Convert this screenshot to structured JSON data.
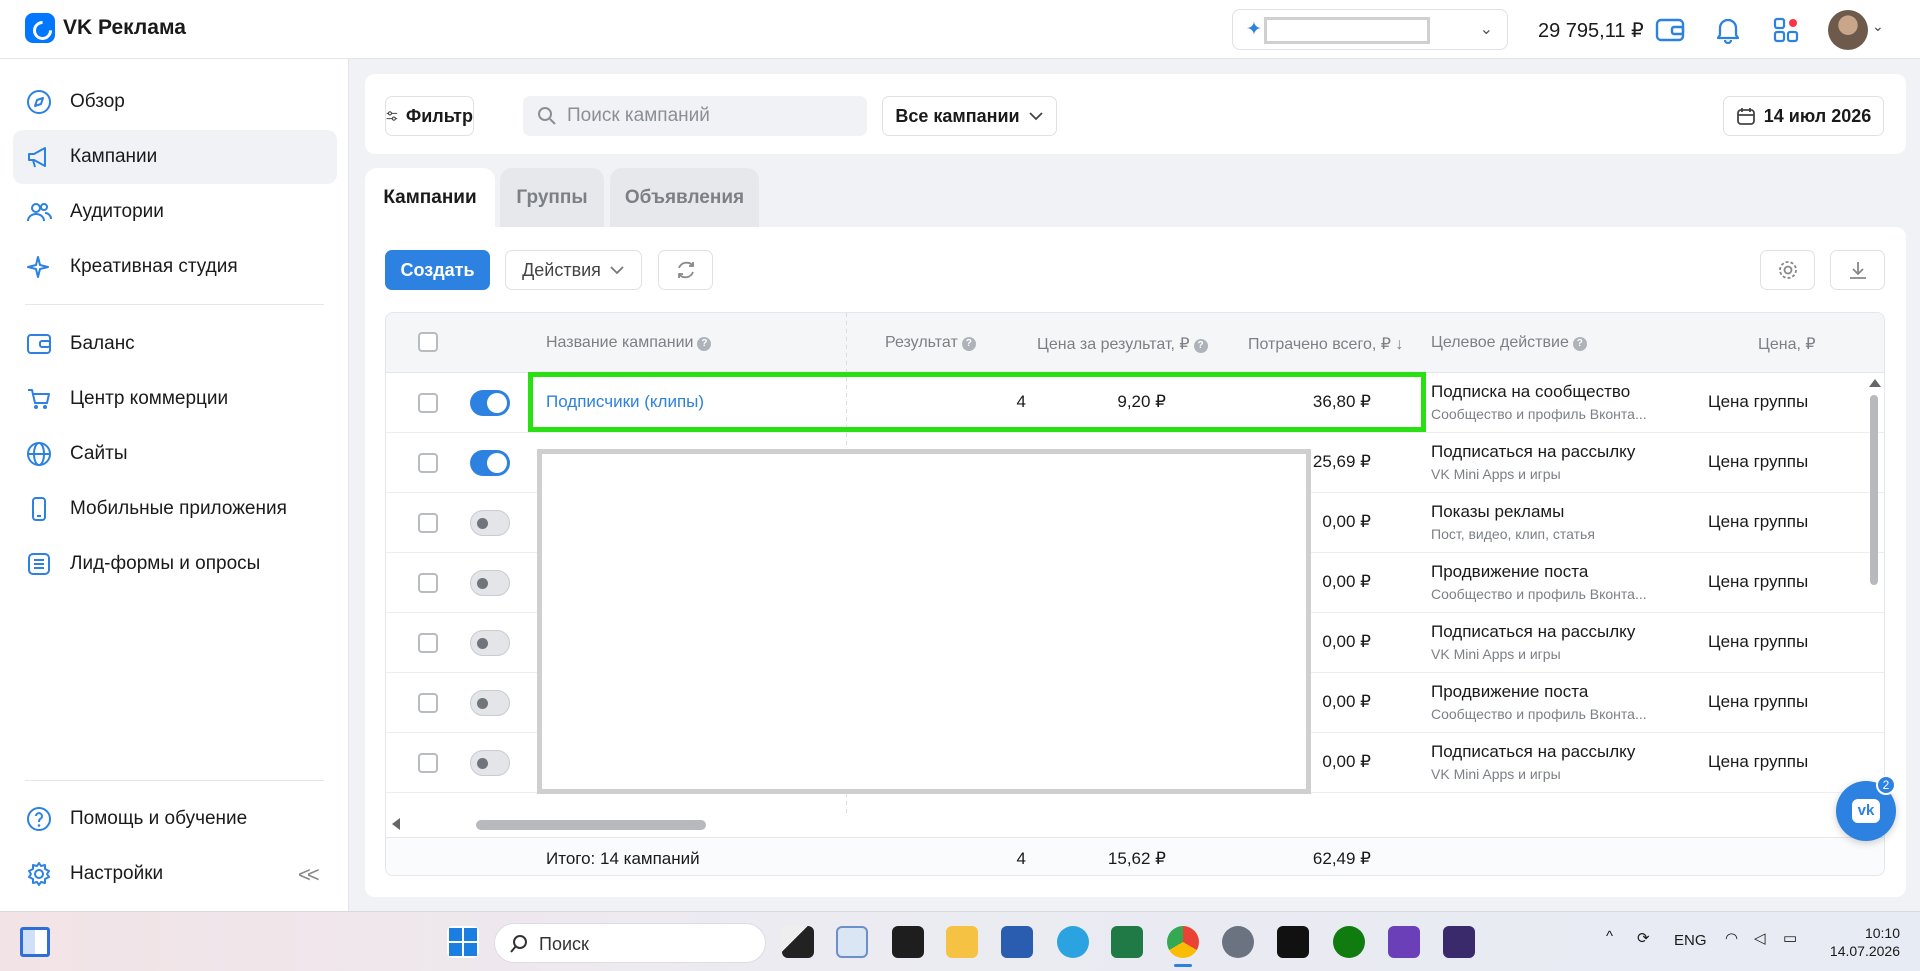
{
  "app": {
    "title": "VK Реклама"
  },
  "header": {
    "balance": "29 795,11 ₽",
    "colors": {
      "accent": "#2d81e0",
      "brand": "#0077ff"
    }
  },
  "sidebar": {
    "items": [
      {
        "label": "Обзор",
        "icon": "compass-icon"
      },
      {
        "label": "Кампании",
        "icon": "megaphone-icon",
        "active": true
      },
      {
        "label": "Аудитории",
        "icon": "users-icon"
      },
      {
        "label": "Креативная студия",
        "icon": "sparkle-icon"
      },
      {
        "label": "Баланс",
        "icon": "wallet-icon"
      },
      {
        "label": "Центр коммерции",
        "icon": "cart-icon"
      },
      {
        "label": "Сайты",
        "icon": "globe-icon"
      },
      {
        "label": "Мобильные приложения",
        "icon": "phone-icon"
      },
      {
        "label": "Лид-формы и опросы",
        "icon": "list-icon"
      }
    ],
    "bottom": [
      {
        "label": "Помощь и обучение",
        "icon": "help-icon"
      },
      {
        "label": "Настройки",
        "icon": "gear-icon"
      }
    ],
    "collapse_label": "<<"
  },
  "filters": {
    "filter_label": "Фильтр",
    "search_placeholder": "Поиск кампаний",
    "scope_label": "Все кампании",
    "date_label": "14 июл 2026"
  },
  "tabs": [
    {
      "label": "Кампании",
      "active": true
    },
    {
      "label": "Группы"
    },
    {
      "label": "Объявления"
    }
  ],
  "toolbar": {
    "create_label": "Создать",
    "actions_label": "Действия"
  },
  "table": {
    "columns": {
      "name": "Название кампании",
      "result": "Результат",
      "cost_per_result": "Цена за результат, ₽",
      "spent": "Потрачено всего, ₽ ↓",
      "target": "Целевое действие",
      "price": "Цена, ₽"
    },
    "rows": [
      {
        "name": "Подписчики (клипы)",
        "enabled": true,
        "result": "4",
        "cost_per_result": "9,20 ₽",
        "spent": "36,80 ₽",
        "target": "Подписка на сообщество",
        "target_sub": "Сообщество и профиль Вконта...",
        "price": "Цена группы"
      },
      {
        "enabled": true,
        "spent": "25,69 ₽",
        "target": "Подписаться на рассылку",
        "target_sub": "VK Mini Apps и игры",
        "price": "Цена группы"
      },
      {
        "enabled": false,
        "spent": "0,00 ₽",
        "target": "Показы рекламы",
        "target_sub": "Пост, видео, клип, статья",
        "price": "Цена группы"
      },
      {
        "enabled": false,
        "spent": "0,00 ₽",
        "target": "Продвижение поста",
        "target_sub": "Сообщество и профиль Вконта...",
        "price": "Цена группы"
      },
      {
        "enabled": false,
        "spent": "0,00 ₽",
        "target": "Подписаться на рассылку",
        "target_sub": "VK Mini Apps и игры",
        "price": "Цена группы"
      },
      {
        "enabled": false,
        "spent": "0,00 ₽",
        "target": "Продвижение поста",
        "target_sub": "Сообщество и профиль Вконта...",
        "price": "Цена группы"
      },
      {
        "enabled": false,
        "spent": "0,00 ₽",
        "target": "Подписаться на рассылку",
        "target_sub": "VK Mini Apps и игры",
        "price": "Цена группы"
      }
    ],
    "footer": {
      "total_label": "Итого: 14 кампаний",
      "result": "4",
      "cost_per_result": "15,62 ₽",
      "spent": "62,49 ₽"
    }
  },
  "support": {
    "badge": "2",
    "icon": "vk-logo-icon"
  },
  "taskbar": {
    "search_label": "Поиск",
    "lang": "ENG",
    "time": "10:10",
    "date": "14.07.2026"
  }
}
